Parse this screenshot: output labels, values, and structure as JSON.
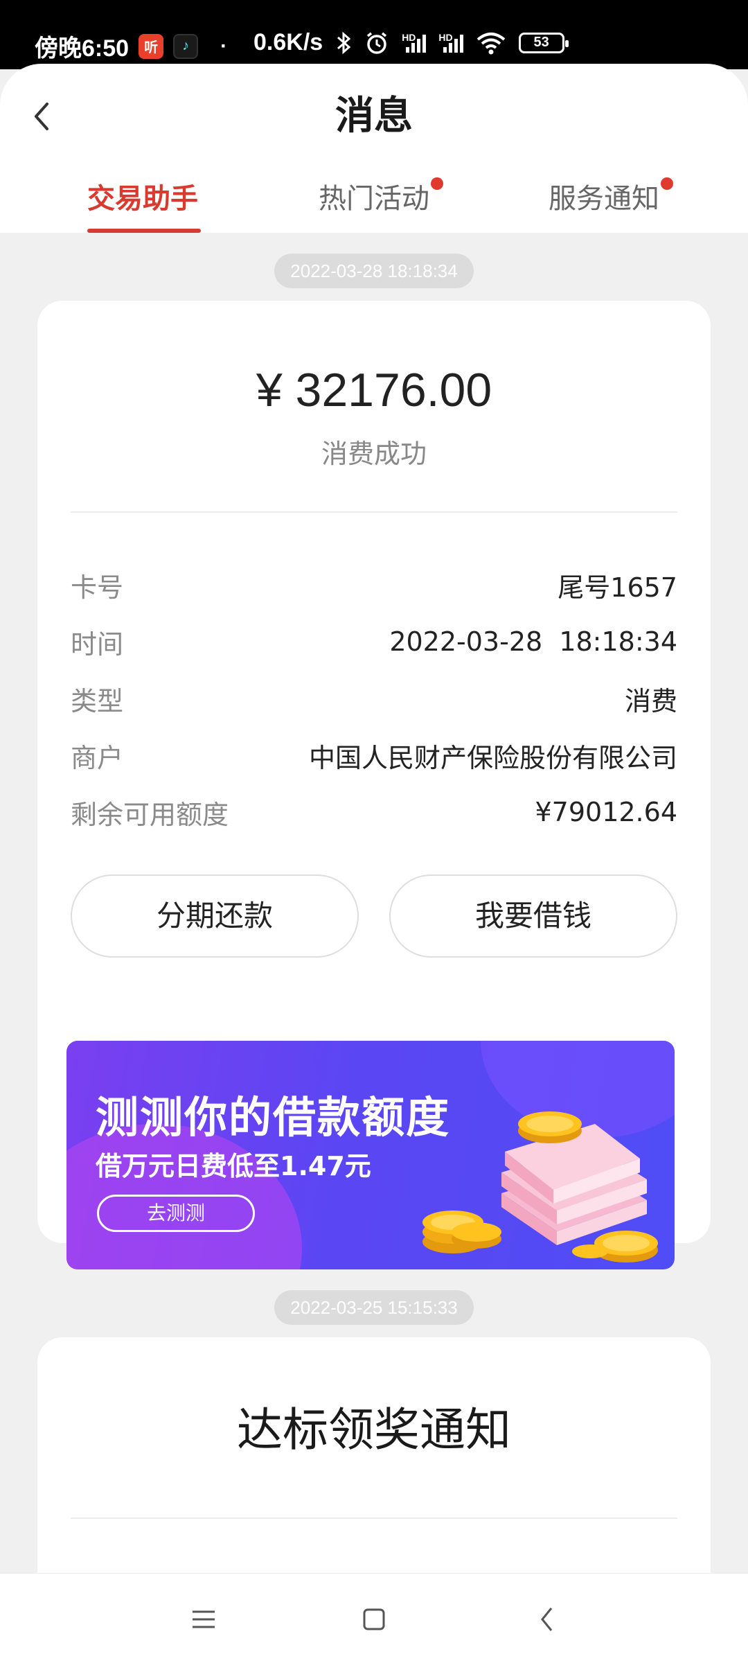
{
  "status_bar": {
    "time": "傍晚6:50",
    "listen_badge": "听",
    "net_speed": "0.6K/s",
    "battery": "53"
  },
  "header": {
    "title": "消息"
  },
  "tabs": [
    {
      "label": "交易助手",
      "active": true,
      "has_dot": false
    },
    {
      "label": "热门活动",
      "active": false,
      "has_dot": true
    },
    {
      "label": "服务通知",
      "active": false,
      "has_dot": true
    }
  ],
  "messages": [
    {
      "timestamp": "2022-03-28 18:18:34",
      "amount": "¥ 32176.00",
      "status": "消费成功",
      "rows": [
        {
          "label": "卡号",
          "value": "尾号1657"
        },
        {
          "label": "时间",
          "value": "2022-03-28  18:18:34"
        },
        {
          "label": "类型",
          "value": "消费"
        },
        {
          "label": "商户",
          "value": "中国人民财产保险股份有限公司"
        },
        {
          "label": "剩余可用额度",
          "value": "¥79012.64"
        }
      ],
      "buttons": [
        "分期还款",
        "我要借钱"
      ],
      "banner": {
        "title": "测测你的借款额度",
        "subtitle": "借万元日费低至1.47元",
        "button": "去测测"
      }
    },
    {
      "timestamp": "2022-03-25 15:15:33",
      "title": "达标领奖通知"
    }
  ],
  "colors": {
    "accent": "#d83a2f",
    "banner_start": "#7a3ff0",
    "banner_end": "#4f4df6"
  }
}
